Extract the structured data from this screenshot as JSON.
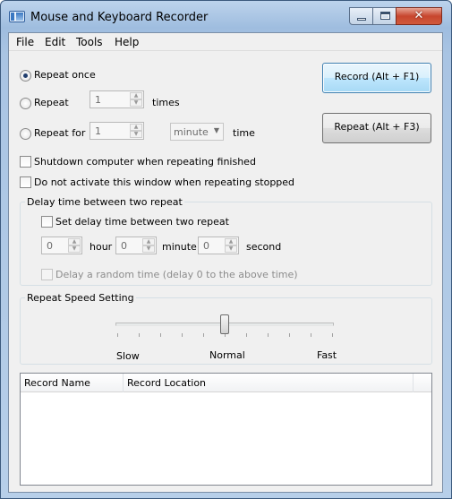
{
  "window": {
    "title": "Mouse and Keyboard Recorder",
    "close_glyph": "✕"
  },
  "menu": [
    "File",
    "Edit",
    "Tools",
    "Help"
  ],
  "repeat_options": {
    "once_label": "Repeat once",
    "times_label": "Repeat",
    "times_value": "1",
    "times_unit": "times",
    "for_label": "Repeat for",
    "for_value": "1",
    "for_unit_selected": "minute",
    "for_suffix": "time",
    "selected": "once"
  },
  "buttons": {
    "record": "Record (Alt + F1)",
    "repeat": "Repeat (Alt + F3)"
  },
  "checkboxes": {
    "shutdown": "Shutdown computer when repeating finished",
    "no_activate": "Do not activate this window when repeating stopped"
  },
  "delay_group": {
    "title": "Delay time between two repeat",
    "set_delay_label": "Set delay time between two repeat",
    "hour_value": "0",
    "hour_label": "hour",
    "minute_value": "0",
    "minute_label": "minute",
    "second_value": "0",
    "second_label": "second",
    "random_label": "Delay a random time (delay 0 to the above time)"
  },
  "speed_group": {
    "title": "Repeat Speed Setting",
    "slow": "Slow",
    "normal": "Normal",
    "fast": "Fast",
    "level": 0.5
  },
  "list": {
    "columns": [
      "Record Name",
      "Record Location"
    ]
  },
  "colors": {
    "title_gradient_top": "#bcd3ec",
    "close_button": "#c7462e",
    "focus_button": "#a7d9f5"
  },
  "icons": {
    "app": "app-window-icon",
    "minimize": "minimize-icon",
    "maximize": "maximize-icon",
    "close": "close-icon"
  }
}
